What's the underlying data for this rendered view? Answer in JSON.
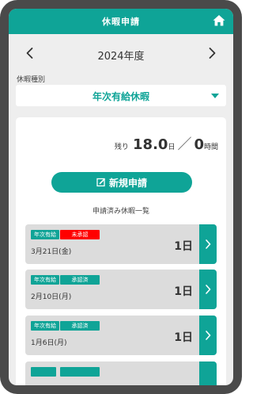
{
  "appbar": {
    "title": "休暇申請",
    "home_icon": "home-icon"
  },
  "year_nav": {
    "year_label": "2024年度",
    "prev_icon": "chevron-left-icon",
    "next_icon": "chevron-right-icon"
  },
  "leave_type": {
    "label": "休暇種別",
    "selected": "年次有給休暇"
  },
  "summary": {
    "remaining_prefix": "残り",
    "days_value": "18.0",
    "days_unit": "日",
    "separator": "／",
    "hours_value": "0",
    "hours_unit": "時間"
  },
  "new_request": {
    "label": "新規申請",
    "icon": "edit-icon"
  },
  "list": {
    "heading": "申請済み休暇一覧",
    "items": [
      {
        "type_badge": "年次有給",
        "status": "未承認",
        "status_kind": "pending",
        "date": "3月21日(金)",
        "days": "1日"
      },
      {
        "type_badge": "年次有給",
        "status": "承認済",
        "status_kind": "approved",
        "date": "2月10日(月)",
        "days": "1日"
      },
      {
        "type_badge": "年次有給",
        "status": "承認済",
        "status_kind": "approved",
        "date": "1月6日(月)",
        "days": "1日"
      }
    ]
  },
  "colors": {
    "primary": "#0fa497",
    "pending": "#ff0000",
    "frame": "#4a4a4a",
    "background": "#eeeeee"
  }
}
